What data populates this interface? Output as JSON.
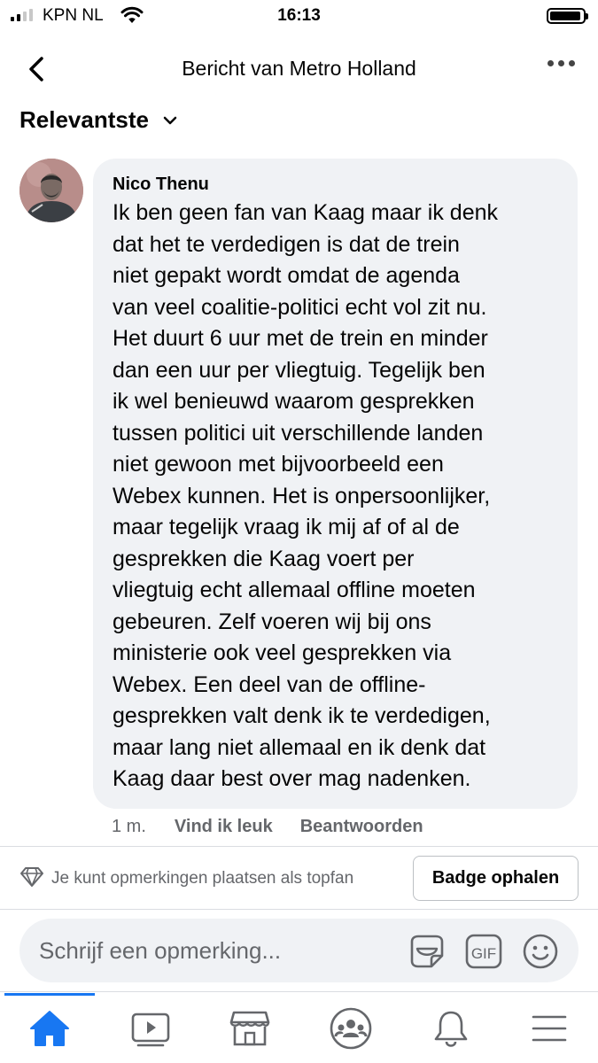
{
  "status_bar": {
    "carrier": "KPN NL",
    "time": "16:13",
    "signal_bars_active": 2,
    "signal_bars_total": 4,
    "battery_level": 0.95
  },
  "header": {
    "title": "Bericht van Metro Holland",
    "back_icon": "chevron-left-icon",
    "more_icon": "more-horizontal-icon"
  },
  "sort": {
    "label": "Relevantste",
    "icon": "chevron-down-icon"
  },
  "comment": {
    "author": "Nico Thenu",
    "lines": [
      "Ik ben geen fan van Kaag maar ik denk",
      "dat het te verdedigen is dat de trein",
      "niet gepakt wordt omdat de agenda",
      "van veel coalitie-politici echt vol zit nu.",
      "Het duurt 6 uur met de trein en minder",
      "dan een uur per vliegtuig. Tegelijk ben",
      "ik wel benieuwd waarom gesprekken",
      "tussen politici uit verschillende landen",
      "niet gewoon met bijvoorbeeld een",
      "Webex kunnen. Het is onpersoonlijker,",
      "maar tegelijk vraag ik mij af of al de",
      "gesprekken die Kaag voert per",
      "vliegtuig echt allemaal offline moeten",
      "gebeuren. Zelf voeren wij bij ons",
      "ministerie ook veel gesprekken via",
      "Webex. Een deel van de offline-",
      "gesprekken valt denk ik te verdedigen,",
      "maar lang niet allemaal en ik denk dat",
      "Kaag daar best over mag nadenken."
    ],
    "time": "1 m.",
    "like_label": "Vind ik leuk",
    "reply_label": "Beantwoorden"
  },
  "topfan": {
    "text": "Je kunt opmerkingen plaatsen als topfan",
    "icon": "diamond-icon",
    "button_label": "Badge ophalen"
  },
  "composer": {
    "placeholder": "Schrijf een opmerking...",
    "icons": [
      "sticker-icon",
      "gif-icon",
      "emoji-icon"
    ],
    "gif_label": "GIF"
  },
  "bottom_nav": {
    "items": [
      "home-icon",
      "video-icon",
      "marketplace-icon",
      "groups-icon",
      "notifications-icon",
      "menu-icon"
    ],
    "active": "home-icon",
    "accent_color": "#1877f2"
  },
  "colors": {
    "accent": "#1877f2",
    "bubble": "#f0f2f5",
    "secondary_text": "#65676b"
  }
}
